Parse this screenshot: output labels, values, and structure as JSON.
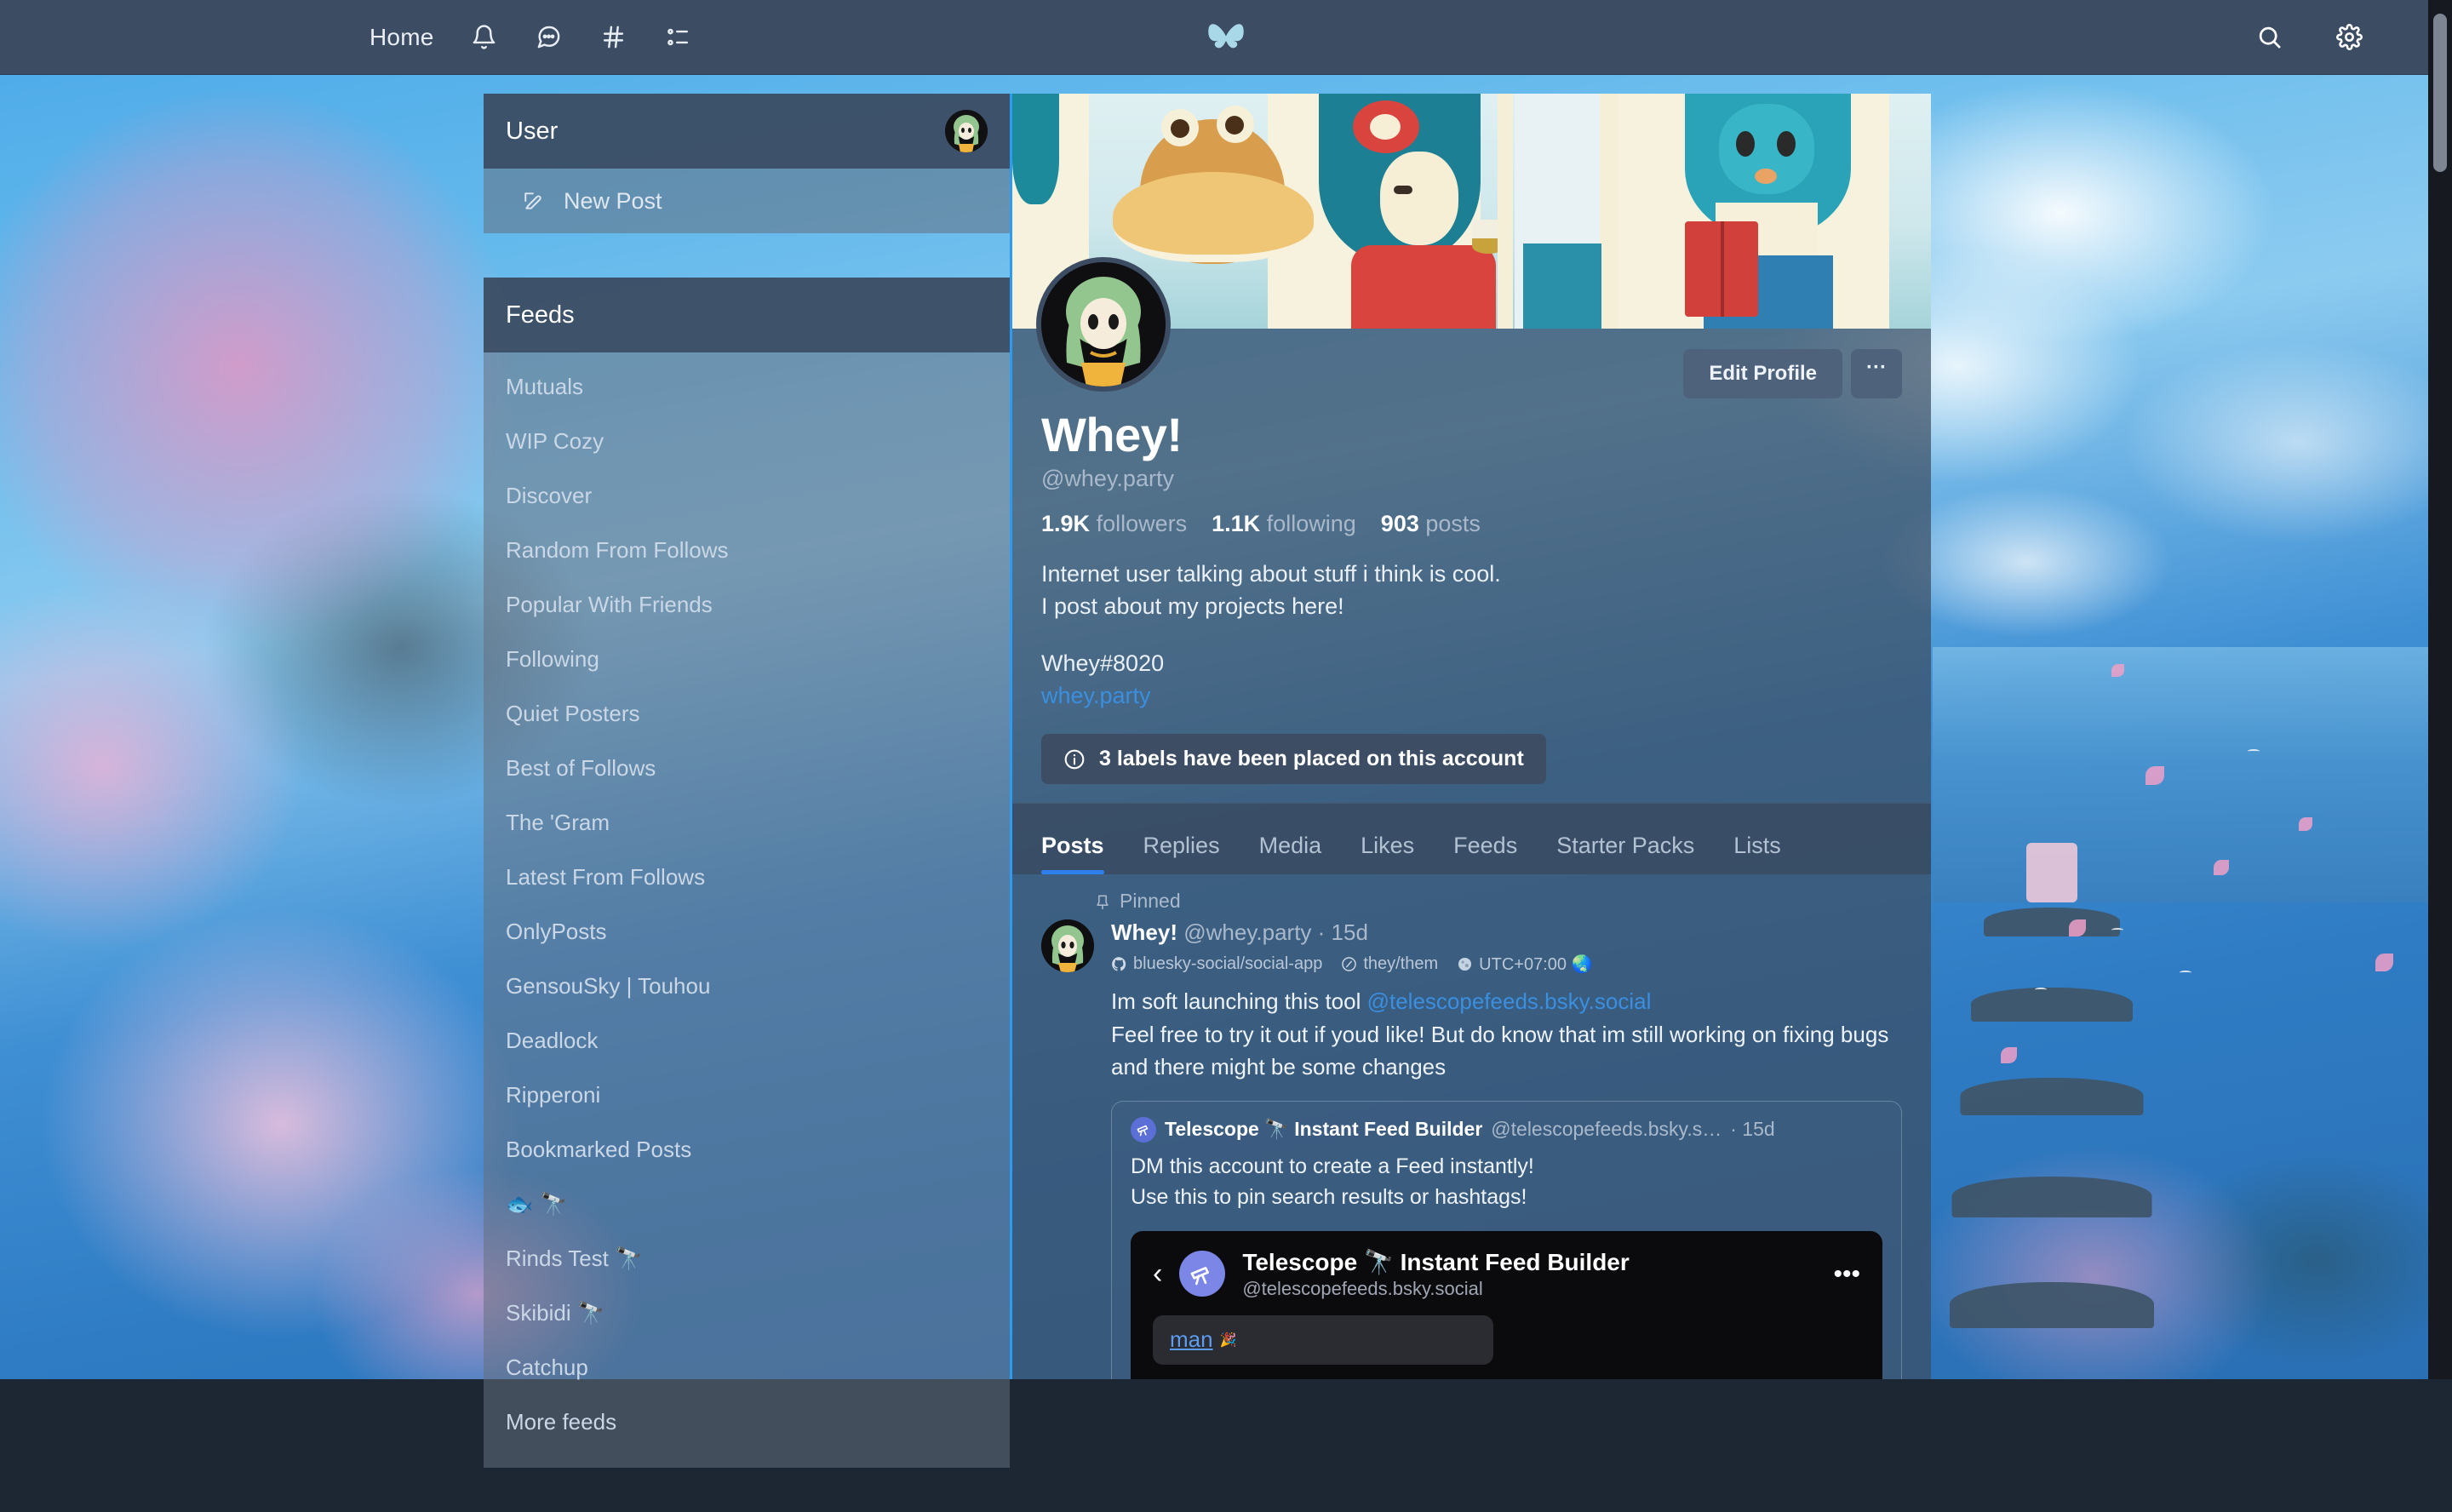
{
  "topnav": {
    "home_label": "Home",
    "icons": [
      "bell-icon",
      "chat-icon",
      "hashtag-icon",
      "lists-icon"
    ],
    "logo": "bluesky-butterfly-logo",
    "right_icons": [
      "search-icon",
      "gear-icon"
    ]
  },
  "sidebar": {
    "user_panel": {
      "title": "User",
      "new_post_label": "New Post"
    },
    "feeds_panel": {
      "title": "Feeds",
      "items": [
        {
          "label": "Mutuals"
        },
        {
          "label": "WIP Cozy"
        },
        {
          "label": "Discover"
        },
        {
          "label": "Random From Follows"
        },
        {
          "label": "Popular With Friends"
        },
        {
          "label": "Following"
        },
        {
          "label": "Quiet Posters"
        },
        {
          "label": "Best of Follows"
        },
        {
          "label": "The 'Gram"
        },
        {
          "label": "Latest From Follows"
        },
        {
          "label": "OnlyPosts"
        },
        {
          "label": "GensouSky | Touhou"
        },
        {
          "label": "Deadlock"
        },
        {
          "label": "Ripperoni"
        },
        {
          "label": "Bookmarked Posts"
        },
        {
          "label": "🐟 🔭"
        },
        {
          "label": "Rinds Test 🔭"
        },
        {
          "label": "Skibidi 🔭"
        },
        {
          "label": "Catchup"
        },
        {
          "label": "More feeds"
        }
      ]
    }
  },
  "profile": {
    "edit_button": "Edit Profile",
    "more_button": "···",
    "display_name": "Whey!",
    "handle": "@whey.party",
    "followers_count": "1.9K",
    "followers_label": "followers",
    "following_count": "1.1K",
    "following_label": "following",
    "posts_count": "903",
    "posts_label": "posts",
    "bio_line1": "Internet user talking about stuff i think is cool.",
    "bio_line2": "I post about my projects here!",
    "bio_line3": "Whey#8020",
    "bio_link": "whey.party",
    "label_notice": "3 labels have been placed on this account"
  },
  "tabs": [
    {
      "label": "Posts",
      "active": true
    },
    {
      "label": "Replies",
      "active": false
    },
    {
      "label": "Media",
      "active": false
    },
    {
      "label": "Likes",
      "active": false
    },
    {
      "label": "Feeds",
      "active": false
    },
    {
      "label": "Starter Packs",
      "active": false
    },
    {
      "label": "Lists",
      "active": false
    }
  ],
  "post": {
    "pinned_label": "Pinned",
    "author_name": "Whey!",
    "author_handle": "@whey.party",
    "timestamp": "· 15d",
    "badge_repo": "bluesky-social/social-app",
    "badge_pronouns": "they/them",
    "badge_timezone": "UTC+07:00 🌏",
    "text_line1_pre": "Im soft launching this tool ",
    "text_mention": "@telescopefeeds.bsky.social",
    "text_line2": "Feel free to try it out if youd like! But do know that im still working on fixing bugs and there might be some changes",
    "quote": {
      "name": "Telescope 🔭 Instant Feed Builder",
      "handle": "@telescopefeeds.bsky.s…",
      "timestamp": "· 15d",
      "line1": "DM this account to create a Feed instantly!",
      "line2": "Use this to pin search results or hashtags!"
    },
    "embed": {
      "back_glyph": "‹",
      "name": "Telescope 🔭 Instant Feed Builder",
      "handle": "@telescopefeeds.bsky.social",
      "menu_glyph": "•••",
      "message_link": "man",
      "message_emoji": "🎉"
    }
  },
  "colors": {
    "nav_bg": "#3c4d63",
    "accent_blue": "#2f80ed",
    "link_blue": "#3a8fe0",
    "butterfly": "#a9d8e8",
    "panel_bg": "#3a4a60"
  }
}
